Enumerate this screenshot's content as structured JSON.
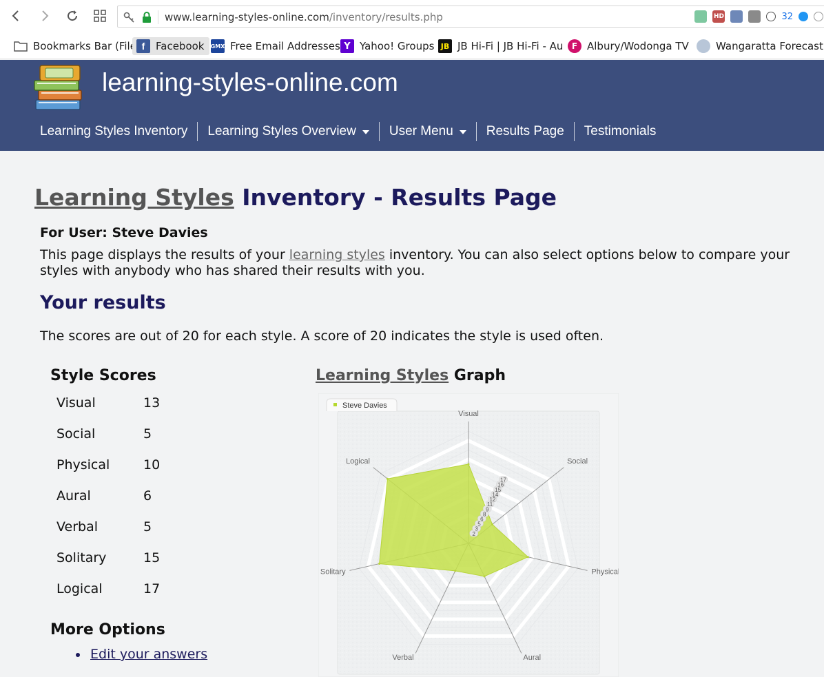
{
  "browser": {
    "url_host": "www.learning-styles-online.com",
    "url_path": "/inventory/results.php",
    "ext_badge": "HD",
    "ext_count": "32",
    "bookmarks": [
      {
        "label": "Bookmarks Bar (File)"
      },
      {
        "label": "Facebook"
      },
      {
        "label": "Free Email Addresses"
      },
      {
        "label": "Yahoo! Groups"
      },
      {
        "label": "JB Hi-Fi | JB Hi-Fi - Au"
      },
      {
        "label": "Albury/Wodonga TV"
      },
      {
        "label": "Wangaratta Forecast"
      }
    ]
  },
  "site": {
    "title": "learning-styles-online.com",
    "menu": [
      {
        "label": "Learning Styles Inventory"
      },
      {
        "label": "Learning Styles Overview"
      },
      {
        "label": "User Menu"
      },
      {
        "label": "Results Page"
      },
      {
        "label": "Testimonials"
      }
    ]
  },
  "page": {
    "title_link": "Learning Styles",
    "title_rest": " Inventory - Results Page",
    "for_user": "For User: Steve Davies",
    "intro_a": "This page displays the results of your ",
    "intro_link": "learning styles",
    "intro_b": " inventory. You can also select options below to compare your styles with anybody who has shared their results with you.",
    "results_heading": "Your results",
    "scores_note": "The scores are out of 20 for each style. A score of 20 indicates the style is used often.",
    "scores_heading": "Style Scores",
    "scores": [
      {
        "style": "Visual",
        "score": "13"
      },
      {
        "style": "Social",
        "score": "5"
      },
      {
        "style": "Physical",
        "score": "10"
      },
      {
        "style": "Aural",
        "score": "6"
      },
      {
        "style": "Verbal",
        "score": "5"
      },
      {
        "style": "Solitary",
        "score": "15"
      },
      {
        "style": "Logical",
        "score": "17"
      }
    ],
    "graph_heading_link": "Learning Styles",
    "graph_heading_rest": " Graph",
    "more_heading": "More Options",
    "more_links": [
      {
        "label": "Edit your answers"
      }
    ]
  },
  "chart_data": {
    "type": "radar",
    "categories": [
      "Visual",
      "Social",
      "Physical",
      "Aural",
      "Verbal",
      "Solitary",
      "Logical"
    ],
    "series": [
      {
        "name": "Steve Davies",
        "values": [
          13,
          5,
          10,
          6,
          5,
          15,
          17
        ]
      }
    ],
    "tick_labels": [
      "2",
      "3",
      "5",
      "6",
      "8",
      "9",
      "11",
      "12",
      "14",
      "15",
      "16",
      "17"
    ],
    "rmax": 20,
    "legend_position": "top-left",
    "fill_color": "#c4e04a"
  }
}
